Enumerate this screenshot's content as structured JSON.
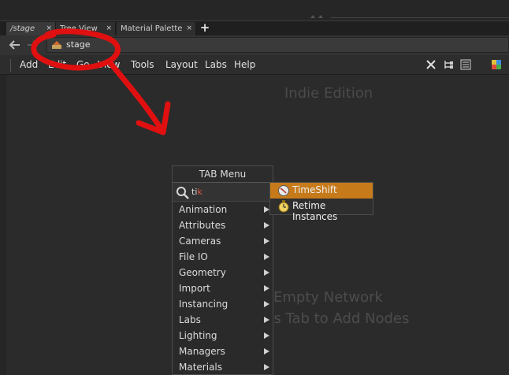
{
  "tabs": [
    {
      "label": "/stage",
      "active": true
    },
    {
      "label": "Tree View",
      "active": false
    },
    {
      "label": "Material Palette",
      "active": false
    }
  ],
  "tab_close_glyph": "×",
  "tab_add_glyph": "+",
  "path": {
    "label": "stage",
    "icon": "stage-icon"
  },
  "menubar": {
    "items": [
      "Add",
      "Edit",
      "Go",
      "View",
      "Tools",
      "Layout",
      "Labs",
      "Help"
    ],
    "tool_icons": [
      "wrench-icon",
      "tree-icon",
      "list-icon",
      "palette-icon"
    ]
  },
  "watermark": "Indie Edition",
  "empty_network": {
    "line1": "Empty Network",
    "line2": "ss Tab to Add Nodes"
  },
  "tab_menu": {
    "title": "TAB Menu",
    "search_prefix": "ti",
    "search_highlight": "k",
    "categories": [
      "Animation",
      "Attributes",
      "Cameras",
      "File IO",
      "Geometry",
      "Import",
      "Instancing",
      "Labs",
      "Lighting",
      "Managers",
      "Materials"
    ]
  },
  "results": [
    {
      "label": "TimeShift",
      "selected": true,
      "icon": "timeshift-icon"
    },
    {
      "label": "Retime Instances",
      "selected": false,
      "icon": "retime-icon"
    }
  ],
  "colors": {
    "selection": "#c67a1a",
    "annotation": "#e01010",
    "search_highlight": "#e0534a"
  }
}
